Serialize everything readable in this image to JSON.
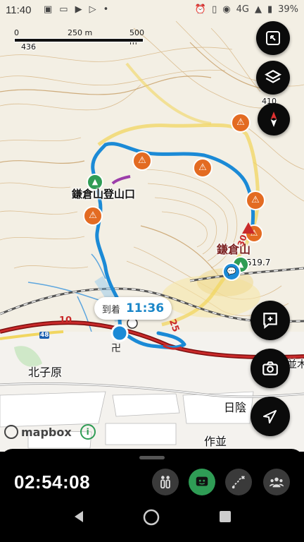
{
  "status_bar": {
    "time": "11:40",
    "network": "4G",
    "battery": "39%",
    "icons": [
      "image-icon",
      "media-icon",
      "youtube-icon",
      "play-icon",
      "dot-icon",
      "alarm-icon",
      "vibrate-icon",
      "signal-icon",
      "battery-icon"
    ]
  },
  "map": {
    "scale": {
      "start": "0",
      "mid": "250 m",
      "end": "500 m"
    },
    "elevations": [
      "436",
      "410",
      "519.7"
    ],
    "trailhead_label": "鎌倉山登山口",
    "peak_label": "鎌倉山",
    "places": [
      "北子原",
      "日陰",
      "作並"
    ],
    "edge_text": "並木",
    "road_numbers": [
      "10",
      "25",
      "30",
      "48"
    ],
    "arrival": {
      "label": "到着",
      "time": "11:36"
    },
    "attribution": "mapbox",
    "info_icon": "i",
    "colors": {
      "route": "#1b8ad6",
      "road_red": "#c92a2a",
      "warning": "#e36b22",
      "yellow_road": "#f2d25a"
    }
  },
  "fabs": {
    "fullscreen": "fullscreen-icon",
    "layers": "layers-icon",
    "compass": "compass-icon",
    "add_note": "add-note-icon",
    "camera": "camera-icon",
    "locate": "locate-icon"
  },
  "bottom_panel": {
    "elapsed_time": "02:54:08",
    "tools": [
      "hikers-icon",
      "chat-icon",
      "route-icon",
      "group-icon"
    ]
  },
  "navbar": [
    "back-icon",
    "home-icon",
    "recent-icon"
  ]
}
